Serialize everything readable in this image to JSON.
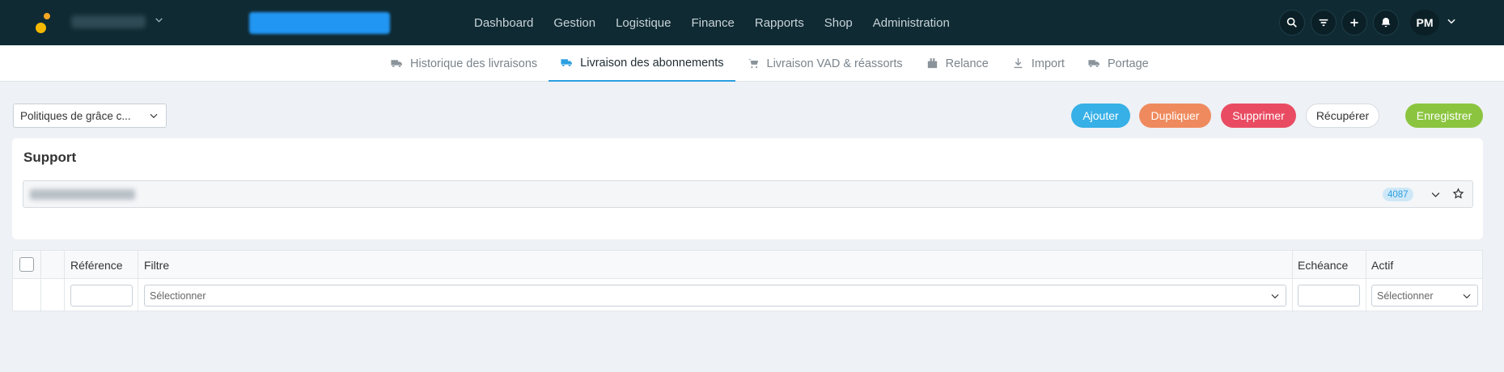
{
  "nav": {
    "menu": [
      "Dashboard",
      "Gestion",
      "Logistique",
      "Finance",
      "Rapports",
      "Shop",
      "Administration"
    ],
    "user_initials": "PM"
  },
  "tabs": [
    {
      "label": "Historique des livraisons",
      "icon": "truck-icon"
    },
    {
      "label": "Livraison des abonnements",
      "icon": "truck-icon",
      "active": true
    },
    {
      "label": "Livraison VAD & réassorts",
      "icon": "cart-icon"
    },
    {
      "label": "Relance",
      "icon": "package-icon"
    },
    {
      "label": "Import",
      "icon": "download-icon"
    },
    {
      "label": "Portage",
      "icon": "truck-icon"
    }
  ],
  "toolbar": {
    "policy_select": "Politiques de grâce c...",
    "ajouter": "Ajouter",
    "dupliquer": "Dupliquer",
    "supprimer": "Supprimer",
    "recuperer": "Récupérer",
    "enregistrer": "Enregistrer"
  },
  "support": {
    "title": "Support",
    "badge": "4087"
  },
  "table": {
    "headers": {
      "reference": "Référence",
      "filtre": "Filtre",
      "echeance": "Echéance",
      "actif": "Actif"
    },
    "filters": {
      "filtre_placeholder": "Sélectionner",
      "actif_placeholder": "Sélectionner"
    }
  },
  "colors": {
    "topbar": "#0f2a33",
    "accent": "#2b9fe0",
    "ajouter": "#36b0e6",
    "dupliquer": "#ef8a5e",
    "supprimer": "#e94c62",
    "enregistrer": "#8bc53f"
  }
}
